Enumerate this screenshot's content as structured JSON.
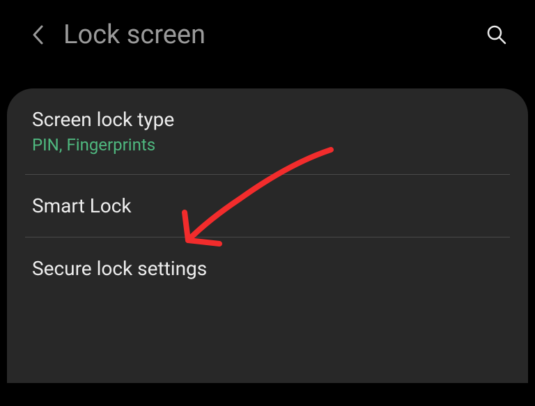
{
  "header": {
    "title": "Lock screen"
  },
  "items": [
    {
      "title": "Screen lock type",
      "subtitle": "PIN, Fingerprints"
    },
    {
      "title": "Smart Lock"
    },
    {
      "title": "Secure lock settings"
    }
  ],
  "annotation": {
    "color": "#f22c2c"
  }
}
